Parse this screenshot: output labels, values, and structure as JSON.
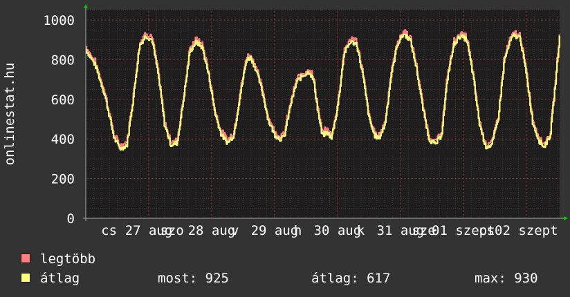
{
  "colors": {
    "background": "#333333",
    "plot_area": "#1e1e1e",
    "grid_major": "#7a2e2e",
    "grid_minor": "#4a3030",
    "text": "#ffffff",
    "arrow": "#00cc00",
    "series_max": "#ff7f7f",
    "series_avg": "#ffff7f"
  },
  "chart_data": {
    "type": "line",
    "ylabel": "onlinestat.hu",
    "ylim": [
      0,
      1050
    ],
    "yticks": [
      0,
      200,
      400,
      600,
      800,
      1000
    ],
    "grid": true,
    "xlim": [
      0,
      7.53
    ],
    "x_ticklabels": [
      {
        "x": 0.37,
        "label": "cs"
      },
      {
        "x": 1.0,
        "label": "27 aug"
      },
      {
        "x": 1.37,
        "label": "szo"
      },
      {
        "x": 2.0,
        "label": "28 aug"
      },
      {
        "x": 2.37,
        "label": "v"
      },
      {
        "x": 3.0,
        "label": "29 aug"
      },
      {
        "x": 3.37,
        "label": "h"
      },
      {
        "x": 4.0,
        "label": "30 aug"
      },
      {
        "x": 4.37,
        "label": "k"
      },
      {
        "x": 5.0,
        "label": "31 aug"
      },
      {
        "x": 5.37,
        "label": "sze"
      },
      {
        "x": 6.0,
        "label": "01 szept"
      },
      {
        "x": 6.37,
        "label": "cs"
      },
      {
        "x": 7.0,
        "label": "02 szept"
      }
    ],
    "keypoints": [
      [
        0.0,
        850
      ],
      [
        0.15,
        770
      ],
      [
        0.3,
        620
      ],
      [
        0.45,
        400
      ],
      [
        0.55,
        350
      ],
      [
        0.65,
        370
      ],
      [
        0.75,
        600
      ],
      [
        0.85,
        870
      ],
      [
        0.95,
        920
      ],
      [
        1.05,
        900
      ],
      [
        1.15,
        720
      ],
      [
        1.25,
        470
      ],
      [
        1.35,
        370
      ],
      [
        1.45,
        380
      ],
      [
        1.55,
        600
      ],
      [
        1.65,
        840
      ],
      [
        1.75,
        890
      ],
      [
        1.85,
        860
      ],
      [
        1.95,
        720
      ],
      [
        2.05,
        530
      ],
      [
        2.15,
        420
      ],
      [
        2.25,
        380
      ],
      [
        2.35,
        420
      ],
      [
        2.45,
        620
      ],
      [
        2.55,
        800
      ],
      [
        2.62,
        810
      ],
      [
        2.7,
        750
      ],
      [
        2.8,
        640
      ],
      [
        2.9,
        490
      ],
      [
        3.0,
        420
      ],
      [
        3.08,
        400
      ],
      [
        3.15,
        410
      ],
      [
        3.25,
        570
      ],
      [
        3.35,
        690
      ],
      [
        3.45,
        720
      ],
      [
        3.55,
        740
      ],
      [
        3.62,
        690
      ],
      [
        3.68,
        550
      ],
      [
        3.75,
        420
      ],
      [
        3.85,
        430
      ],
      [
        3.9,
        400
      ],
      [
        4.0,
        560
      ],
      [
        4.1,
        830
      ],
      [
        4.2,
        890
      ],
      [
        4.3,
        880
      ],
      [
        4.4,
        720
      ],
      [
        4.5,
        500
      ],
      [
        4.58,
        420
      ],
      [
        4.65,
        400
      ],
      [
        4.75,
        470
      ],
      [
        4.85,
        720
      ],
      [
        4.95,
        880
      ],
      [
        5.05,
        930
      ],
      [
        5.15,
        900
      ],
      [
        5.25,
        760
      ],
      [
        5.35,
        560
      ],
      [
        5.45,
        400
      ],
      [
        5.55,
        370
      ],
      [
        5.65,
        420
      ],
      [
        5.75,
        720
      ],
      [
        5.85,
        880
      ],
      [
        5.95,
        920
      ],
      [
        6.05,
        900
      ],
      [
        6.15,
        720
      ],
      [
        6.25,
        480
      ],
      [
        6.35,
        360
      ],
      [
        6.45,
        370
      ],
      [
        6.55,
        500
      ],
      [
        6.65,
        800
      ],
      [
        6.75,
        900
      ],
      [
        6.8,
        920
      ],
      [
        6.9,
        910
      ],
      [
        7.0,
        720
      ],
      [
        7.1,
        480
      ],
      [
        7.2,
        390
      ],
      [
        7.28,
        360
      ],
      [
        7.38,
        420
      ],
      [
        7.46,
        680
      ],
      [
        7.53,
        925
      ]
    ],
    "series": [
      {
        "name": "legtöbb",
        "color": "#ff7f7f",
        "offset": 18
      },
      {
        "name": "átlag",
        "color": "#ffff7f",
        "offset": 0
      }
    ]
  },
  "legend": {
    "max_label": "legtöbb",
    "avg_label": "átlag",
    "current": "most: 925",
    "average": "átlag: 617",
    "maximum": "max: 930"
  }
}
